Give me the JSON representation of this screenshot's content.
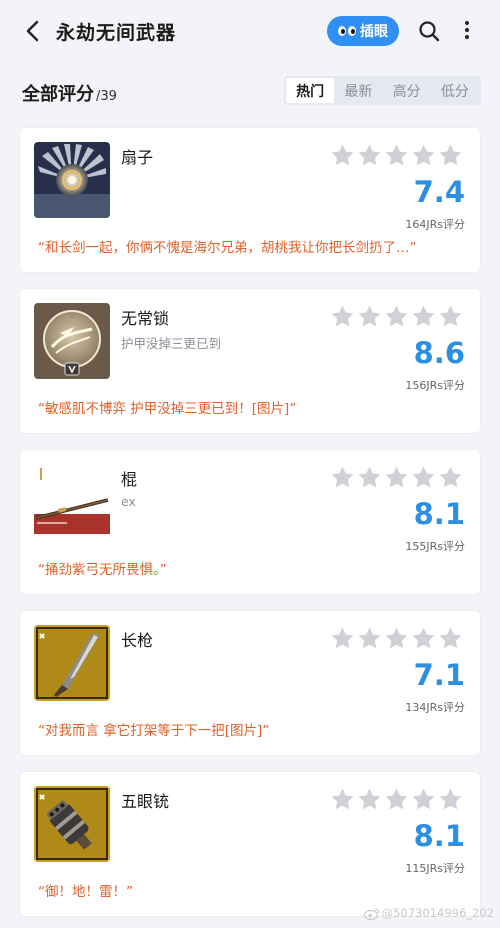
{
  "header": {
    "title": "永劫无间武器",
    "badge_label": "插眼"
  },
  "section": {
    "title": "全部评分",
    "count": "/39",
    "tabs": [
      "热门",
      "最新",
      "高分",
      "低分"
    ],
    "active_tab": "热门"
  },
  "items": [
    {
      "name": "扇子",
      "subtitle": "",
      "score": "7.4",
      "ratings": "164JRs评分",
      "quote": "“和长剑一起，你俩不愧是海尔兄弟，胡桃我让你把长剑扔了…”",
      "stars": 5
    },
    {
      "name": "无常锁",
      "subtitle": "护甲没掉三更已到",
      "score": "8.6",
      "ratings": "156JRs评分",
      "quote": "“敏感肌不博弈 护甲没掉三更已到！[图片]”",
      "stars": 5
    },
    {
      "name": "棍",
      "subtitle": "ex",
      "score": "8.1",
      "ratings": "155JRs评分",
      "quote": "“捅劲紫弓无所畏惧。”",
      "stars": 5
    },
    {
      "name": "长枪",
      "subtitle": "",
      "score": "7.1",
      "ratings": "134JRs评分",
      "quote": "“对我而言   拿它打架等于下一把[图片]”",
      "stars": 5
    },
    {
      "name": "五眼铳",
      "subtitle": "",
      "score": "8.1",
      "ratings": "115JRs评分",
      "quote": "“御！地！雷！”",
      "stars": 5
    }
  ],
  "watermark": "@5073014996_202",
  "colors": {
    "accent": "#2f8ff2",
    "score": "#2d8fe0",
    "quote": "#e0602a",
    "star": "#cfd1d6"
  }
}
